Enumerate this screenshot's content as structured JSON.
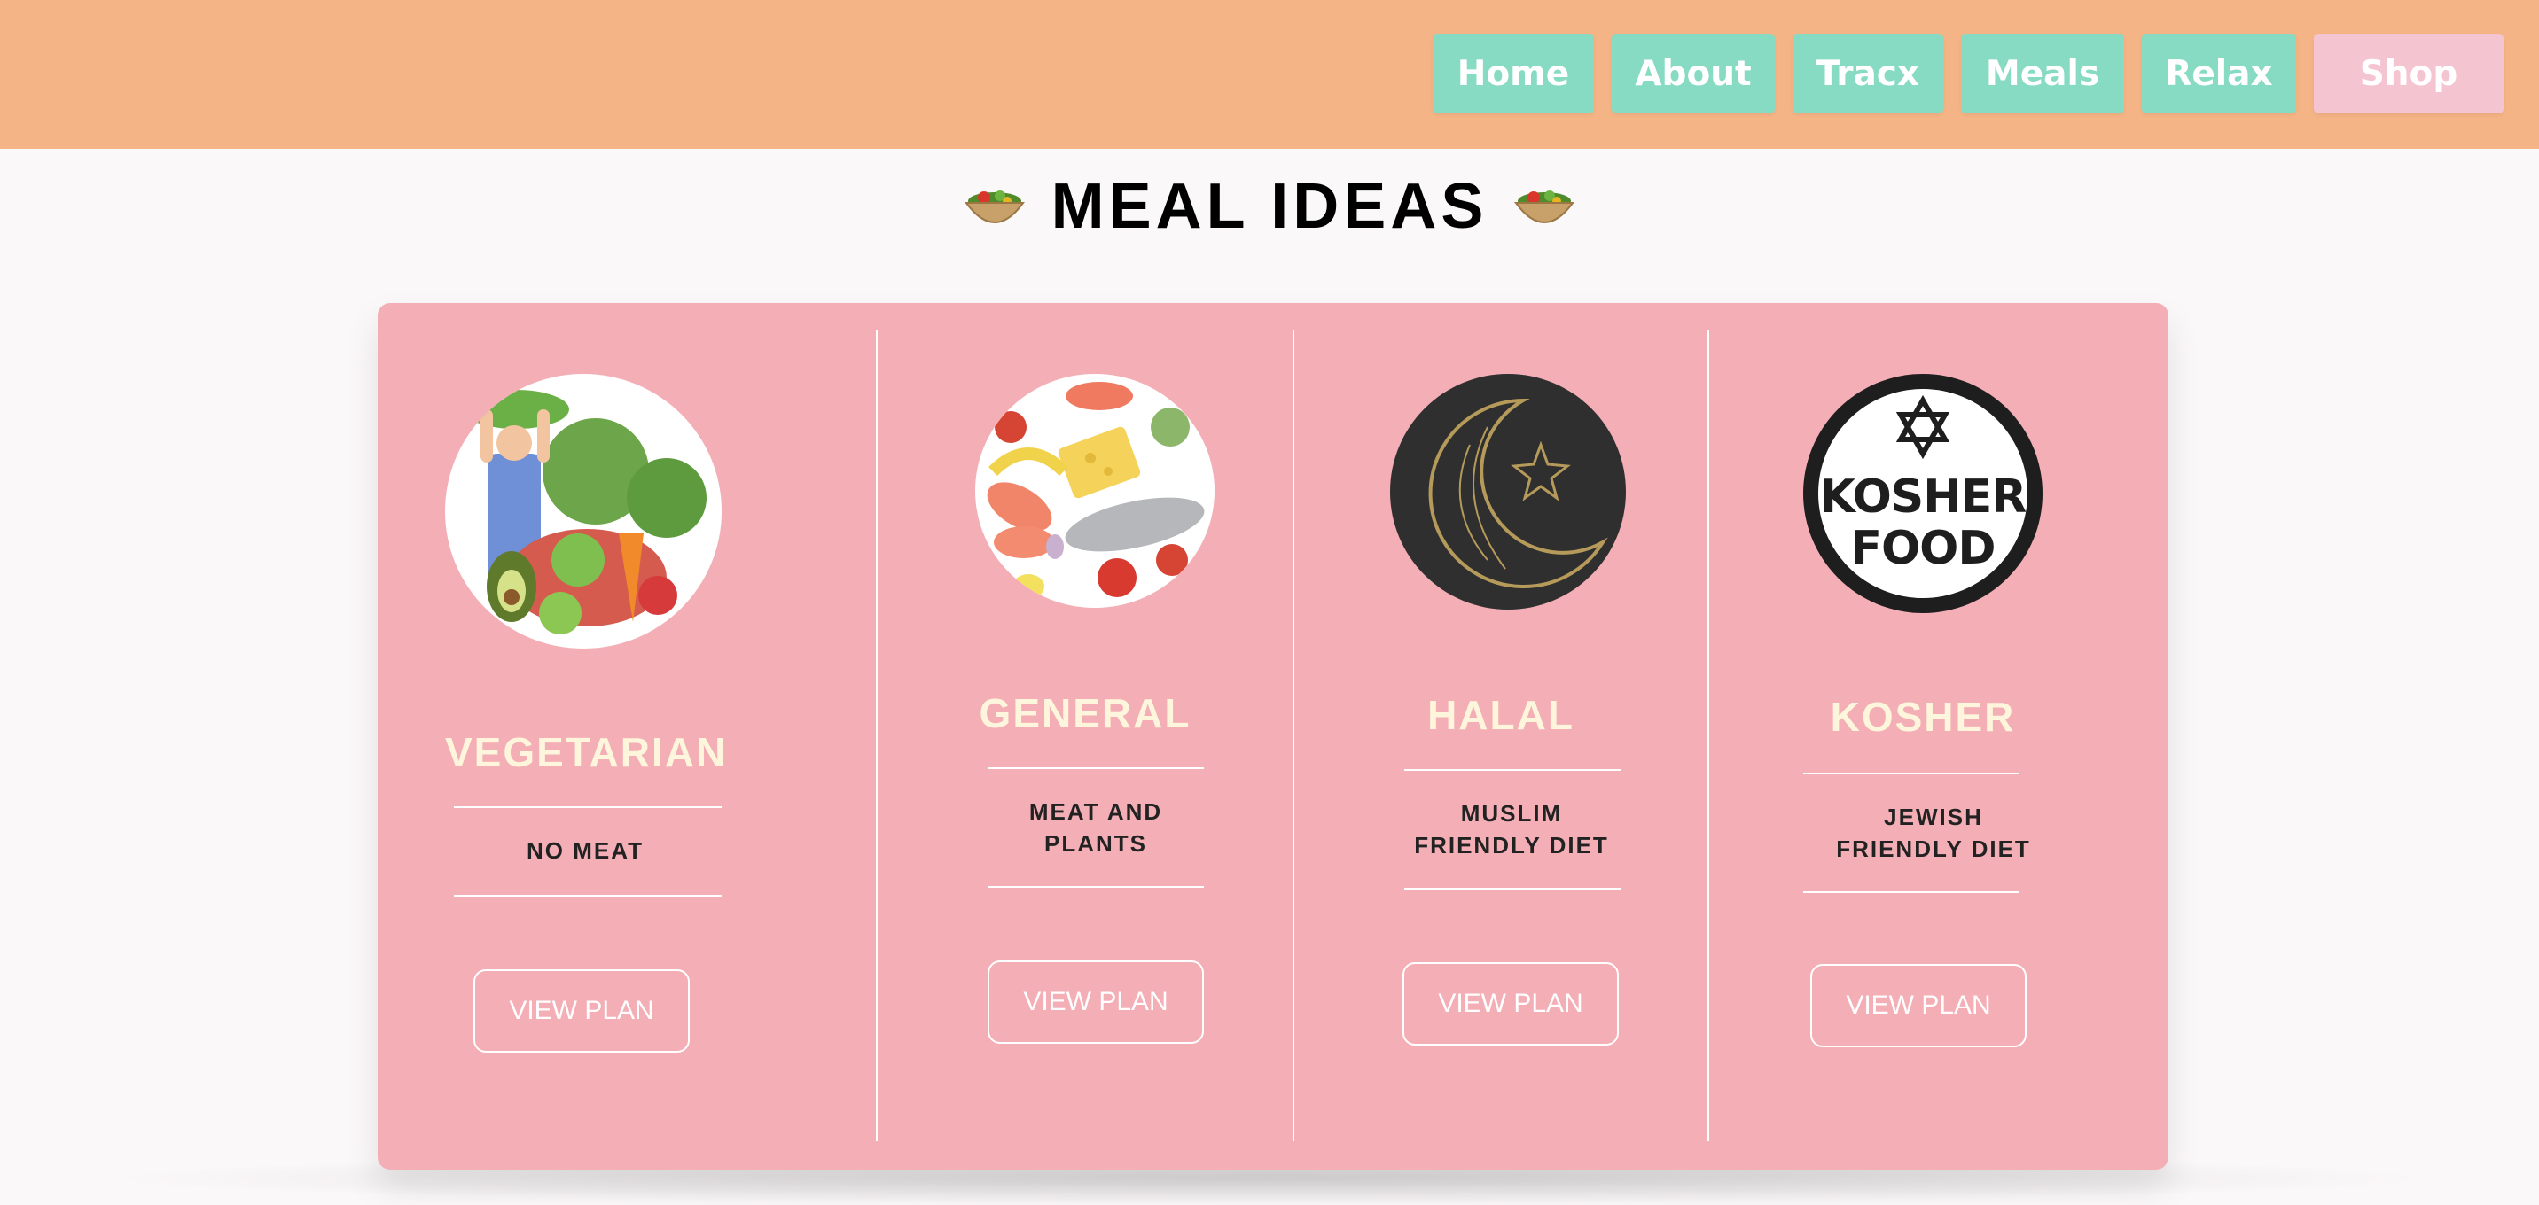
{
  "nav": {
    "items": [
      {
        "label": "Home"
      },
      {
        "label": "About"
      },
      {
        "label": "Tracx"
      },
      {
        "label": "Meals"
      },
      {
        "label": "Relax"
      },
      {
        "label": "Shop"
      }
    ]
  },
  "page": {
    "title": "MEAL IDEAS",
    "title_icon": "salad-bowl-icon"
  },
  "cards": [
    {
      "title": "VEGETARIAN",
      "desc_line1": "NO MEAT",
      "desc_line2": "",
      "button": "VIEW PLAN",
      "image": "vegetarian-illustration"
    },
    {
      "title": "GENERAL",
      "desc_line1": "MEAT AND",
      "desc_line2": "PLANTS",
      "button": "VIEW PLAN",
      "image": "general-food-illustration"
    },
    {
      "title": "HALAL",
      "desc_line1": "MUSLIM",
      "desc_line2": "FRIENDLY DIET",
      "button": "VIEW PLAN",
      "image": "crescent-star-logo"
    },
    {
      "title": "KOSHER",
      "desc_line1": "JEWISH",
      "desc_line2": "FRIENDLY DIET",
      "button": "VIEW PLAN",
      "image": "kosher-food-logo",
      "logo_text_1": "KOSHER",
      "logo_text_2": "FOOD"
    }
  ],
  "colors": {
    "header": "#f5b486",
    "nav_button": "#87dbc2",
    "nav_shop": "#f5c4d1",
    "panel": "#f4aeb6",
    "card_title": "#fdf6dc"
  }
}
